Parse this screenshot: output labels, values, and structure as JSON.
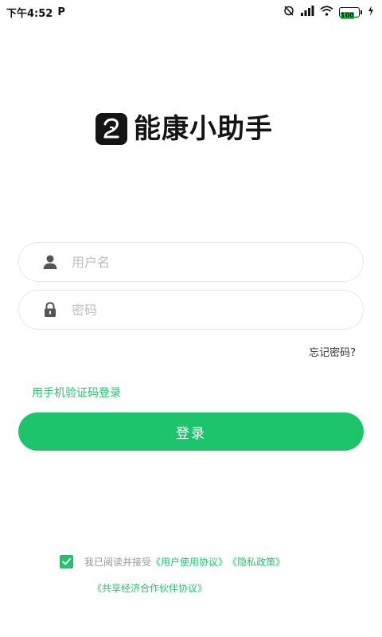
{
  "status_bar": {
    "time": "下午4:52",
    "p_label": "P",
    "battery": "100"
  },
  "logo": {
    "app_name": "能康小助手"
  },
  "login_form": {
    "username_placeholder": "用户名",
    "password_placeholder": "密码",
    "forgot_password": "忘记密码?",
    "sms_login": "用手机验证码登录",
    "login_button": "登录"
  },
  "agreement": {
    "prefix": "我已阅读并接受",
    "user_agreement": "《用户使用协议》",
    "privacy_policy": "《隐私政策》",
    "sharing_agreement": "《共享经济合作伙伴协议》",
    "checked": true
  },
  "colors": {
    "accent": "#1ec46b"
  }
}
